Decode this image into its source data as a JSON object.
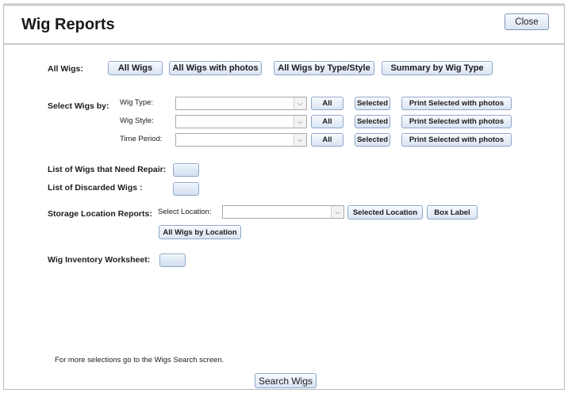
{
  "window": {
    "title": "Wig Reports",
    "close_label": "Close"
  },
  "all_wigs": {
    "label": "All Wigs:",
    "buttons": [
      "All Wigs",
      "All Wigs with photos",
      "All Wigs by Type/Style",
      "Summary by Wig Type"
    ]
  },
  "select_wigs": {
    "label": "Select Wigs by:",
    "rows": [
      {
        "label": "Wig Type:",
        "value": "",
        "all": "All",
        "selected": "Selected",
        "print": "Print Selected with photos"
      },
      {
        "label": "Wig Style:",
        "value": "",
        "all": "All",
        "selected": "Selected",
        "print": "Print Selected with photos"
      },
      {
        "label": "Time Period:",
        "value": "",
        "all": "All",
        "selected": "Selected",
        "print": "Print Selected with photos"
      }
    ]
  },
  "repair": {
    "label": "List of Wigs that Need Repair:"
  },
  "discarded": {
    "label": "List of Discarded Wigs :"
  },
  "storage": {
    "label": "Storage Location Reports:",
    "select_label": "Select Location:",
    "value": "",
    "selected_location": "Selected Location",
    "box_label": "Box Label",
    "all_by_location": "All Wigs by Location"
  },
  "inventory": {
    "label": "Wig Inventory Worksheet:"
  },
  "footer": {
    "note": "For more selections go to the Wigs Search screen.",
    "search_button": "Search  Wigs"
  },
  "icons": {
    "dropdown": "chevron-down-icon"
  },
  "colors": {
    "button_top": "#f7fafe",
    "button_bottom": "#d9e4f3",
    "button_border": "#8ea6c8"
  }
}
